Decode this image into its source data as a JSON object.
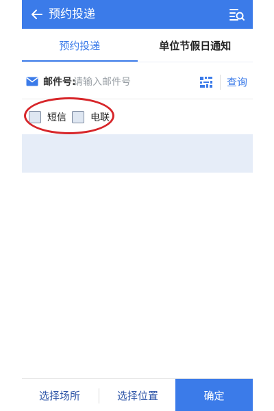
{
  "header": {
    "title": "预约投递",
    "back_icon": "arrow-left-icon",
    "menu_icon": "list-search-icon"
  },
  "tabs": [
    {
      "label": "预约投递",
      "active": true
    },
    {
      "label": "单位节假日通知",
      "active": false
    }
  ],
  "search": {
    "label": "邮件号:",
    "placeholder": "请输入邮件号",
    "value": "",
    "scan_icon": "scan-code-icon",
    "query_label": "查询"
  },
  "options": [
    {
      "label": "短信",
      "checked": false
    },
    {
      "label": "电联",
      "checked": false
    }
  ],
  "bottom": {
    "venue_label": "选择场所",
    "location_label": "选择位置",
    "confirm_label": "确定"
  },
  "colors": {
    "primary": "#3b7be9",
    "highlight": "#d7262a",
    "band": "#e6edf8"
  }
}
